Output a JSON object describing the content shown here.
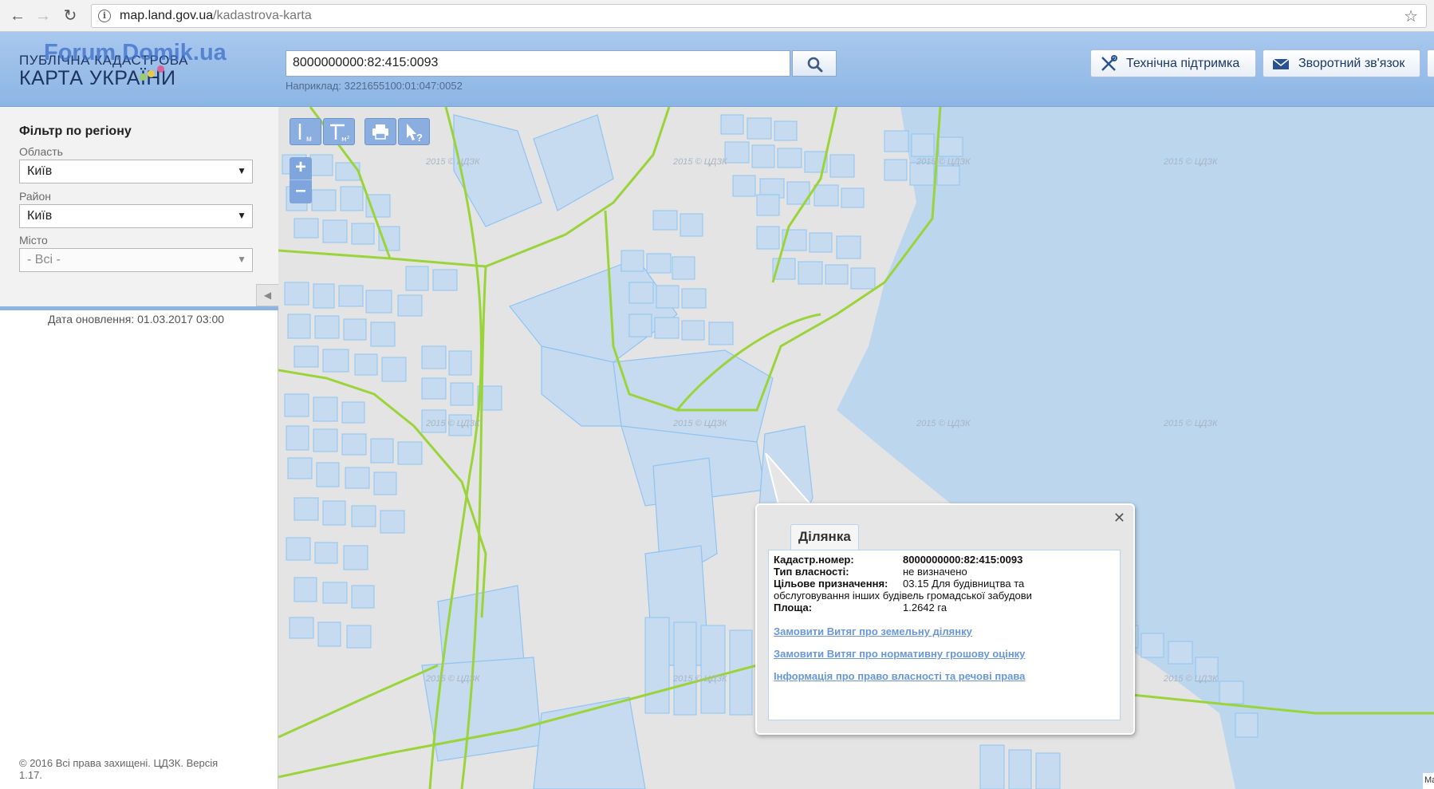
{
  "browser": {
    "url_host": "map.land.gov.ua",
    "url_path": "/kadastrova-karta"
  },
  "header": {
    "logo_line1": "ПУБЛІЧНА КАДАСТРОВА",
    "logo_line2": "КАРТА УКРАЇНИ",
    "watermark": "Forum.Domik.ua",
    "search_value": "8000000000:82:415:0093",
    "search_hint": "Наприклад: 3221655100:01:047:0052",
    "support_label": "Технічна підтримка",
    "feedback_label": "Зворотний зв'язок"
  },
  "sidebar": {
    "filter_title": "Фільтр по регіону",
    "oblast_label": "Область",
    "oblast_value": "Київ",
    "raion_label": "Район",
    "raion_value": "Київ",
    "misto_label": "Місто",
    "misto_value": "- Всі -",
    "update_date": "Дата оновлення: 01.03.2017 03:00",
    "copyright": "© 2016 Всі права захищені. ЦДЗК. Версія 1.17."
  },
  "map": {
    "tile_watermark": "2015 © ЦДЗК",
    "ruler_label": "м",
    "area_label": "м²",
    "zoom_in": "+",
    "zoom_out": "–",
    "corner_label": "Ma"
  },
  "popup": {
    "tab_label": "Ділянка",
    "close": "✕",
    "rows": [
      {
        "label": "Кадастр.номер:",
        "value": "8000000000:82:415:0093"
      },
      {
        "label": "Тип власності:",
        "value": "не визначено"
      },
      {
        "label": "Цільове призначення:",
        "value": "03.15 Для будівництва та"
      },
      {
        "label": "",
        "value": "обслуговування інших будівель громадської забудови"
      },
      {
        "label": "Площа:",
        "value": "1.2642 га"
      }
    ],
    "links": [
      "Замовити Витяг про земельну ділянку",
      "Замовити Витяг про нормативну грошову оцінку",
      "Інформація про право власності та речові права"
    ]
  },
  "colors": {
    "header_blue": "#8db5e4",
    "parcel_fill": "#c6dbef",
    "parcel_stroke": "#8fc4f2",
    "boundary_green": "#9bd43a",
    "water": "#bcd6ee",
    "link": "#6b97d6"
  }
}
